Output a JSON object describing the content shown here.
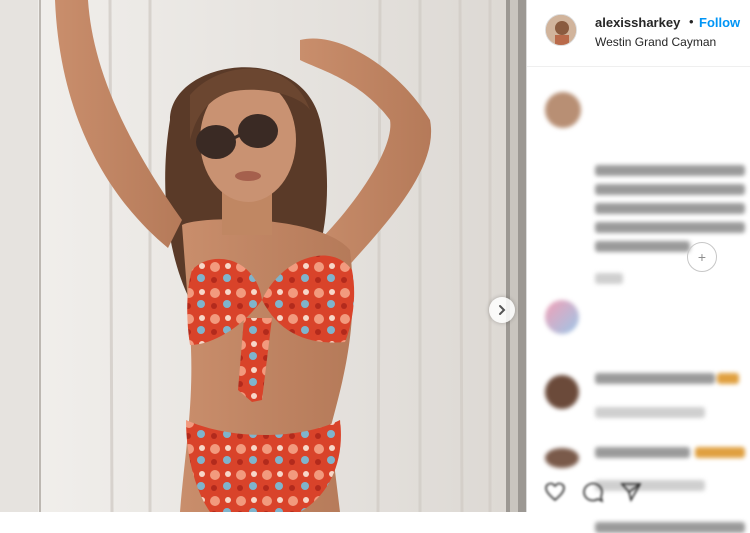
{
  "post": {
    "username": "alexissharkey",
    "separator": "•",
    "follow_label": "Follow",
    "location": "Westin Grand Cayman"
  },
  "photo": {
    "next_arrow": "chevron-right-icon"
  },
  "comments_area": {
    "note": ""
  },
  "colors": {
    "follow_blue": "#0095f6",
    "text_dark": "#262626",
    "bikini_red": "#d9432a",
    "curtain": "#e9e6e2"
  }
}
